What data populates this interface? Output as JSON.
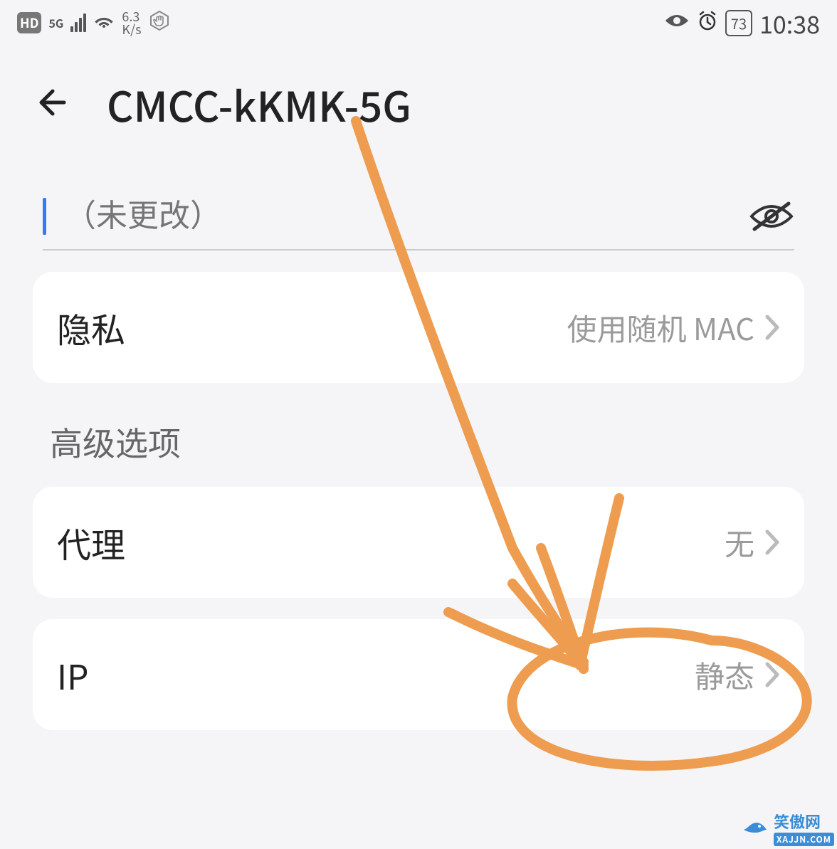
{
  "status": {
    "hd": "HD",
    "network_badge": "5G",
    "speed_value": "6.3",
    "speed_unit": "K/s",
    "battery": "73",
    "time": "10:38"
  },
  "title": "CMCC-kKMK-5G",
  "password": {
    "placeholder": "（未更改）"
  },
  "privacy": {
    "label": "隐私",
    "value": "使用随机 MAC"
  },
  "section_advanced": "高级选项",
  "proxy": {
    "label": "代理",
    "value": "无"
  },
  "ip": {
    "label": "IP",
    "value": "静态"
  },
  "watermark": {
    "text": "笑傲网",
    "sub": "XAJJN.COM"
  },
  "colors": {
    "annotation": "#ee9c4f",
    "accent": "#2e7cf6"
  }
}
